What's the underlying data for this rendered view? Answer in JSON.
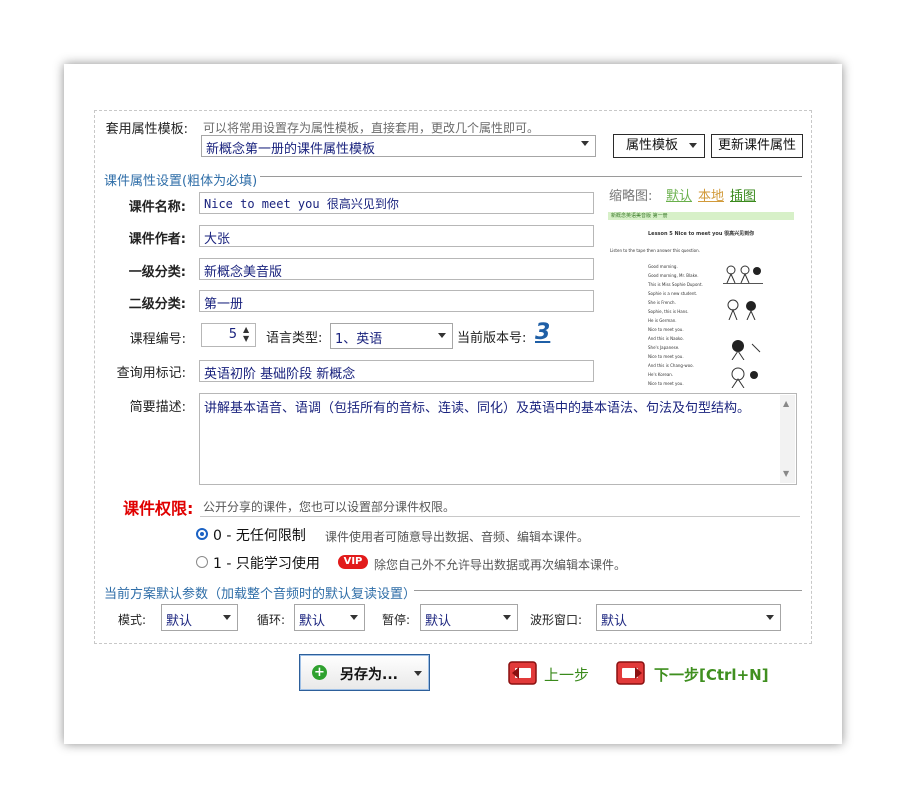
{
  "template": {
    "label": "套用属性模板:",
    "hint": "可以将常用设置存为属性模板，直接套用，更改几个属性即可。",
    "selected": "新概念第一册的课件属性模板",
    "template_button": "属性模板",
    "update_button": "更新课件属性"
  },
  "props": {
    "section_title": "课件属性设置(粗体为必填)",
    "name_label": "课件名称:",
    "name_value": "Nice to meet you 很高兴见到你",
    "author_label": "课件作者:",
    "author_value": "大张",
    "cat1_label": "一级分类:",
    "cat1_value": "新概念美音版",
    "cat2_label": "二级分类:",
    "cat2_value": "第一册",
    "number_label": "课程编号:",
    "number_value": "5",
    "lang_label": "语言类型:",
    "lang_value": "1、英语",
    "version_label": "当前版本号:",
    "version_value": "3",
    "tags_label": "查询用标记:",
    "tags_value": "英语初阶 基础阶段 新概念",
    "desc_label": "简要描述:",
    "desc_value": "讲解基本语音、语调（包括所有的音标、连读、同化）及英语中的基本语法、句法及句型结构。"
  },
  "thumbnail": {
    "label": "缩略图:",
    "default_link": "默认",
    "local_link": "本地",
    "illus_link": "插图",
    "header": "新概念英语美音版 第一册",
    "lesson_title": "Lesson 5   Nice to meet you   很高兴见到你",
    "question": "Listen to the tape then answer this question.",
    "rows": [
      "Good morning.",
      "Good morning, Mr. Blake.",
      "This is Miss Sophie Dupont.",
      "Sophie is a new student.",
      "She is French.",
      "Sophie, this is Hans.",
      "He is German.",
      "Nice to meet you.",
      "And this is Naoko.",
      "She's Japanese.",
      "Nice to meet you.",
      "And this is Chang-woo.",
      "He's Korean.",
      "Nice to meet you."
    ]
  },
  "perm": {
    "label": "课件权限:",
    "hint": "公开分享的课件，您也可以设置部分课件权限。",
    "option0": "0 - 无任何限制",
    "option0_desc": "课件使用者可随意导出数据、音频、编辑本课件。",
    "option1": "1 - 只能学习使用",
    "vip": "VIP",
    "option1_desc": "除您自己外不允许导出数据或再次编辑本课件。"
  },
  "defaults": {
    "section_title": "当前方案默认参数（加载整个音频时的默认复读设置）",
    "mode_label": "模式:",
    "mode_value": "默认",
    "loop_label": "循环:",
    "loop_value": "默认",
    "pause_label": "暂停:",
    "pause_value": "默认",
    "wave_label": "波形窗口:",
    "wave_value": "默认"
  },
  "footer": {
    "save_as": "另存为...",
    "prev": "上一步",
    "next": "下一步[Ctrl+N]"
  },
  "colors": {
    "section_blue": "#2f6ea8",
    "perm_red": "#e00000",
    "link_green": "#3a8a1c",
    "next_green": "#3f8f1f"
  }
}
